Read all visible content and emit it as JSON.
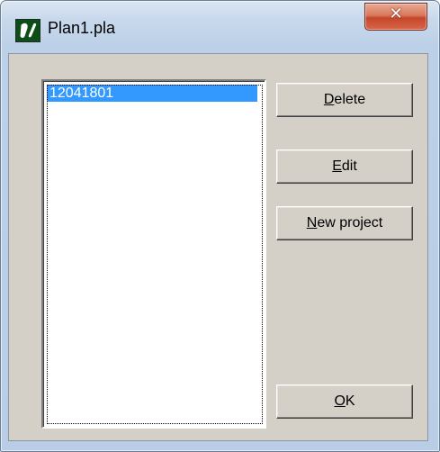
{
  "window": {
    "title": "Plan1.pla",
    "close_glyph": "✕",
    "app_icon": "app-logo-icon"
  },
  "listbox": {
    "items": [
      "12041801"
    ],
    "selected_index": 0
  },
  "buttons": {
    "delete": {
      "mnemonic": "D",
      "rest": "elete"
    },
    "edit": {
      "mnemonic": "E",
      "rest": "dit"
    },
    "new_project": {
      "mnemonic": "N",
      "rest": "ew project"
    },
    "ok": {
      "mnemonic": "O",
      "rest": "K"
    }
  },
  "colors": {
    "selection": "#3399ff",
    "dialog_face": "#d4d0c8",
    "close_button": "#c7462a"
  }
}
